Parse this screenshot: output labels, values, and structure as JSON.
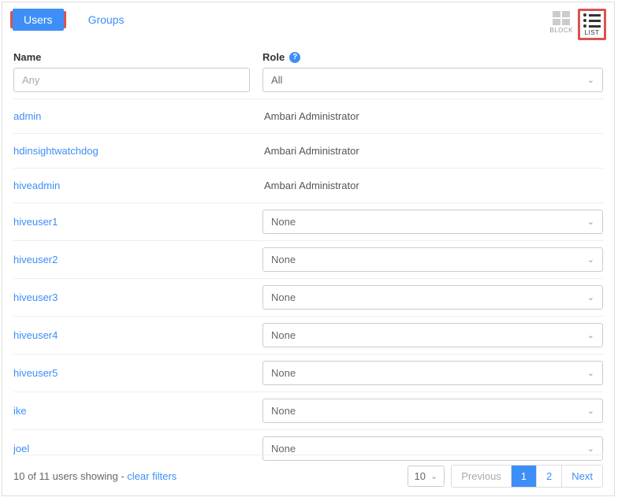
{
  "tabs": {
    "users": "Users",
    "groups": "Groups",
    "active": "users"
  },
  "viewToggle": {
    "block": "BLOCK",
    "list": "LIST",
    "active": "list"
  },
  "columns": {
    "name": "Name",
    "role": "Role"
  },
  "filters": {
    "name_placeholder": "Any",
    "role_value": "All"
  },
  "rows": [
    {
      "name": "admin",
      "role": "Ambari Administrator",
      "editable": false
    },
    {
      "name": "hdinsightwatchdog",
      "role": "Ambari Administrator",
      "editable": false
    },
    {
      "name": "hiveadmin",
      "role": "Ambari Administrator",
      "editable": false
    },
    {
      "name": "hiveuser1",
      "role": "None",
      "editable": true
    },
    {
      "name": "hiveuser2",
      "role": "None",
      "editable": true
    },
    {
      "name": "hiveuser3",
      "role": "None",
      "editable": true
    },
    {
      "name": "hiveuser4",
      "role": "None",
      "editable": true
    },
    {
      "name": "hiveuser5",
      "role": "None",
      "editable": true
    },
    {
      "name": "ike",
      "role": "None",
      "editable": true
    },
    {
      "name": "joel",
      "role": "None",
      "editable": true
    }
  ],
  "footer": {
    "status_prefix": "10 of 11 users showing - ",
    "clear_filters": "clear filters",
    "page_size": "10",
    "previous": "Previous",
    "page1": "1",
    "page2": "2",
    "next": "Next"
  }
}
